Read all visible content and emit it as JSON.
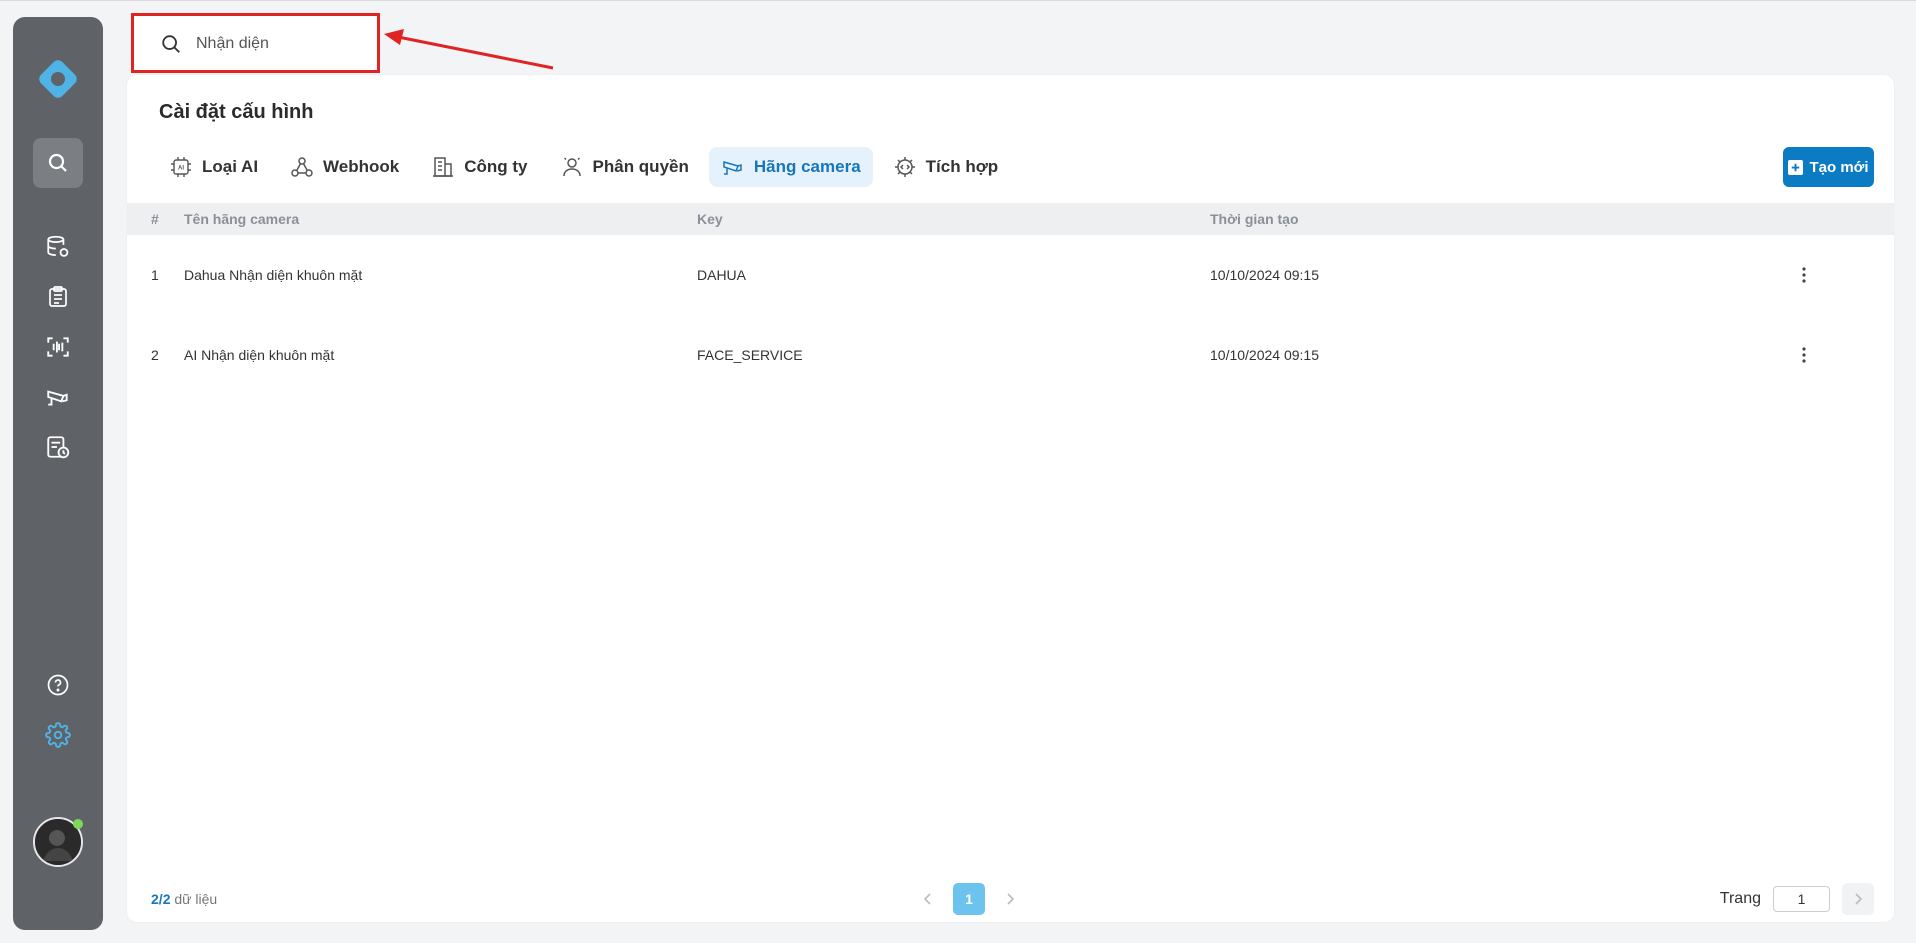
{
  "search": {
    "value": "Nhận diện",
    "placeholder": ""
  },
  "page": {
    "title": "Cài đặt cấu hình"
  },
  "tabs": [
    {
      "label": "Loại AI",
      "icon": "ai-chip-icon"
    },
    {
      "label": "Webhook",
      "icon": "webhook-icon"
    },
    {
      "label": "Công ty",
      "icon": "building-icon"
    },
    {
      "label": "Phân quyền",
      "icon": "users-icon"
    },
    {
      "label": "Hãng camera",
      "icon": "camera-icon",
      "active": true
    },
    {
      "label": "Tích hợp",
      "icon": "integration-icon"
    }
  ],
  "toolbar": {
    "create_label": "Tạo mới"
  },
  "table": {
    "headers": {
      "index": "#",
      "name": "Tên hãng camera",
      "key": "Key",
      "time": "Thời gian tạo"
    },
    "rows": [
      {
        "index": "1",
        "name": "Dahua Nhận diện khuôn mặt",
        "key": "DAHUA",
        "time": "10/10/2024 09:15"
      },
      {
        "index": "2",
        "name": "AI Nhận diện khuôn mặt",
        "key": "FACE_SERVICE",
        "time": "10/10/2024 09:15"
      }
    ]
  },
  "footer": {
    "count_shown": "2",
    "count_sep": "/",
    "count_total": "2",
    "count_suffix": " dữ liệu",
    "current_page": "1",
    "goto_label": "Trang",
    "goto_value": "1"
  },
  "colors": {
    "accent": "#0b7cc4",
    "sidebar": "#5f6368",
    "highlight": "#e02424"
  }
}
